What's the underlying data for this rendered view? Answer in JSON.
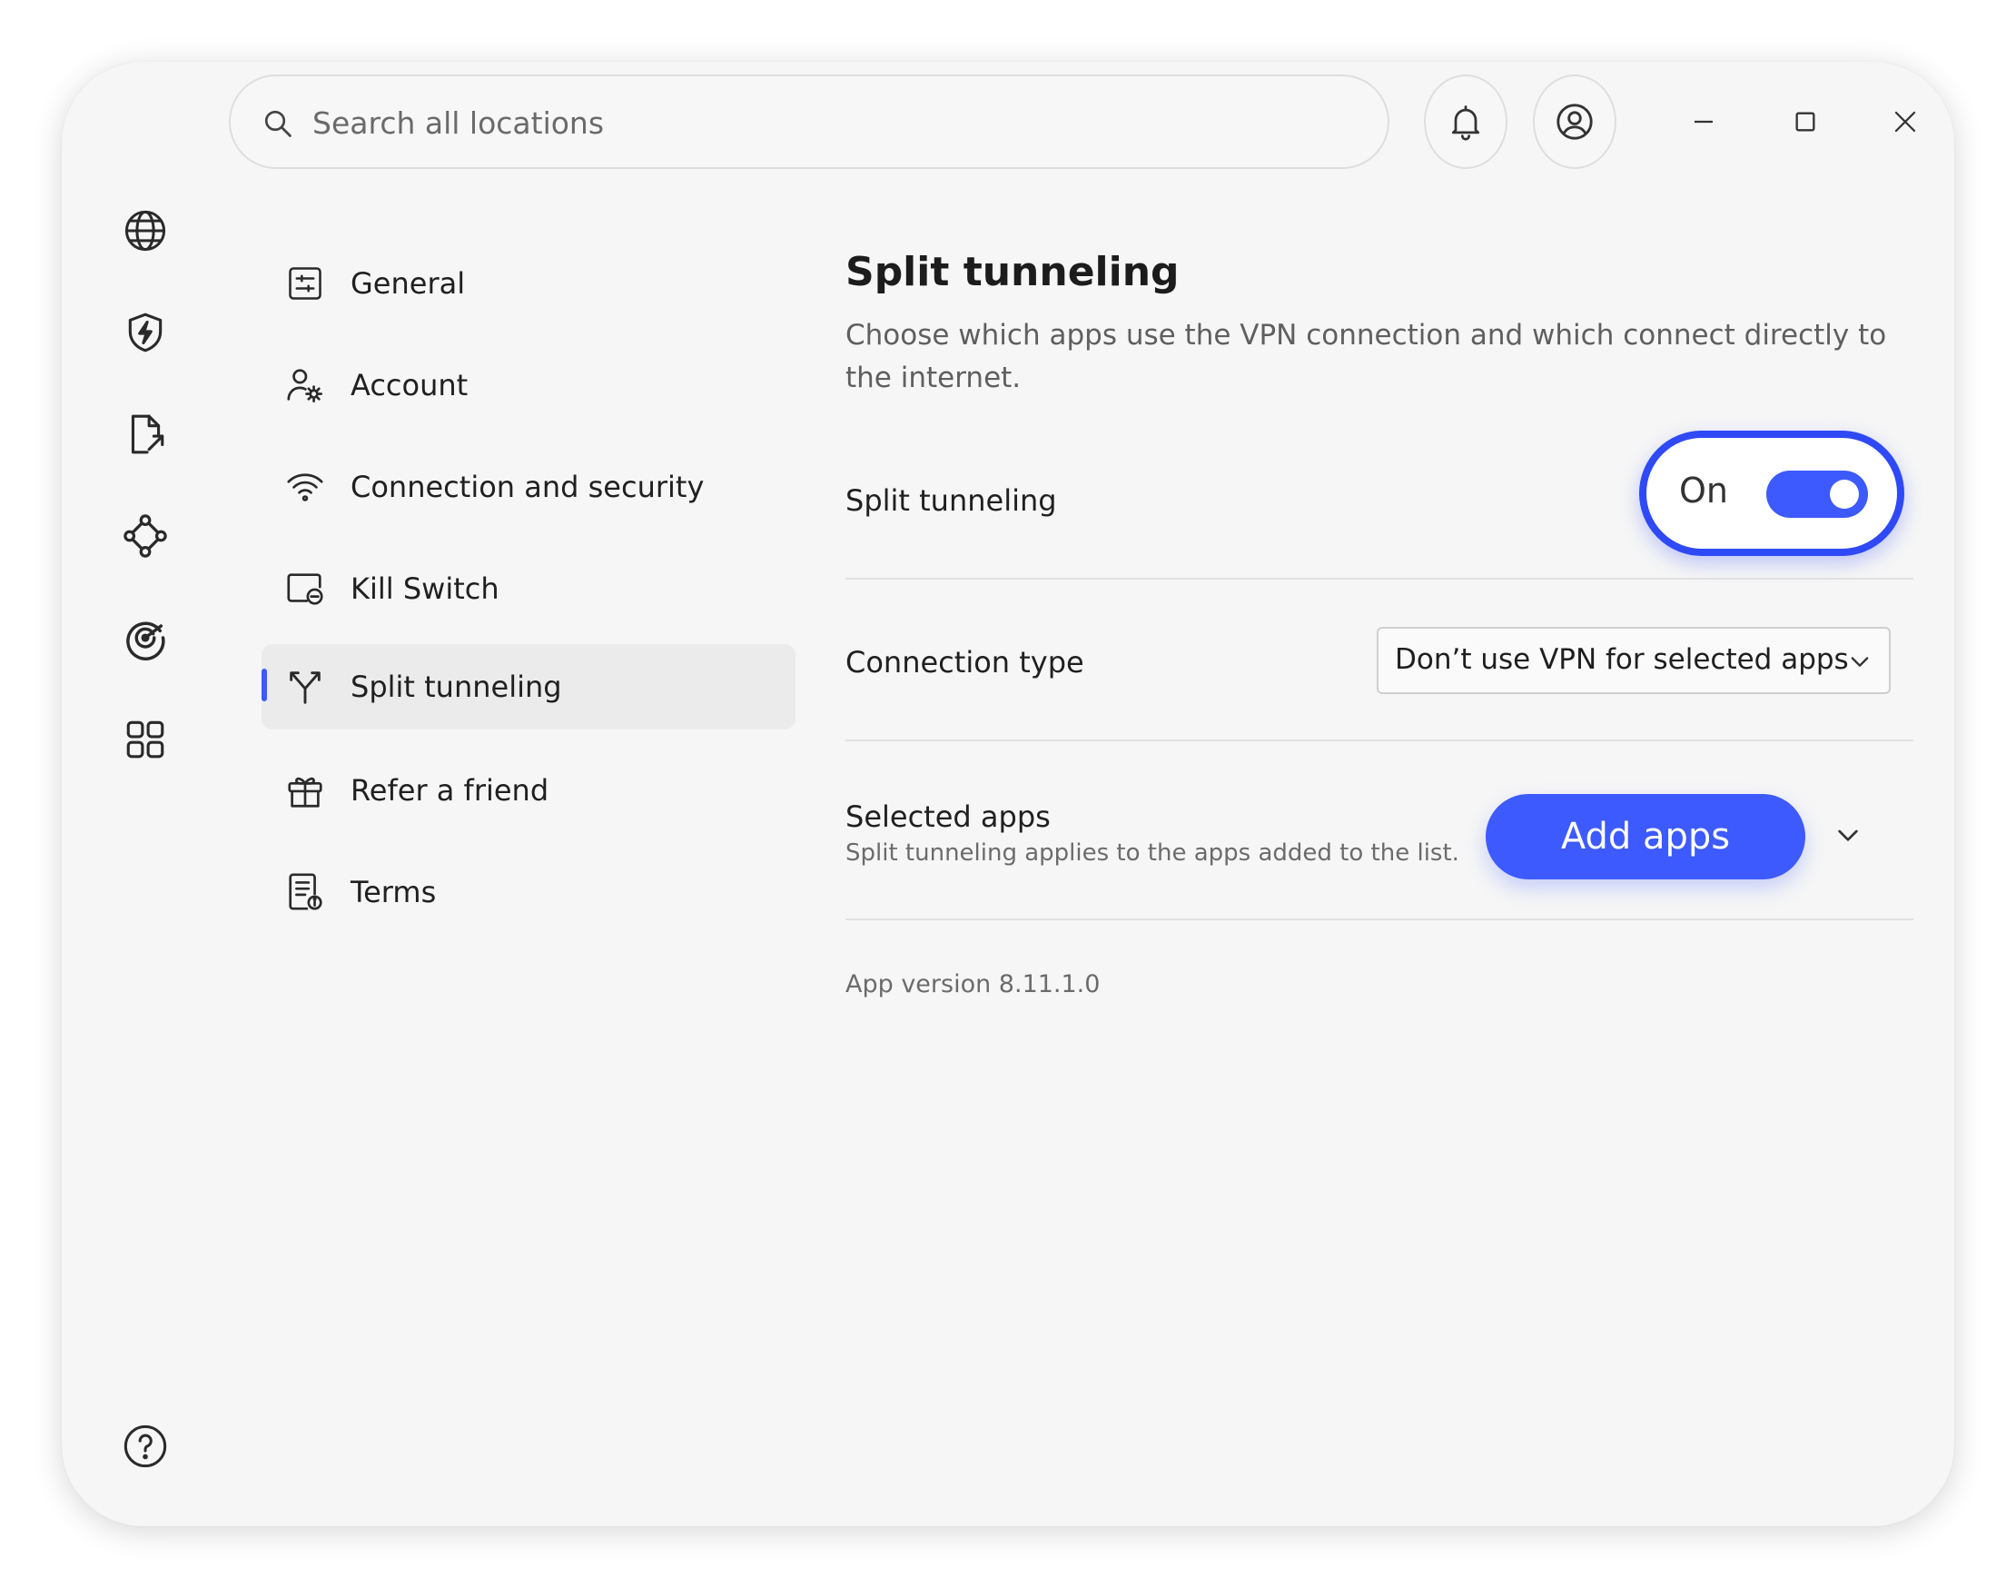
{
  "search": {
    "placeholder": "Search all locations"
  },
  "header": {
    "icons": [
      "bell-icon",
      "user-account-icon"
    ],
    "window_controls": [
      "minimize-icon",
      "maximize-icon",
      "close-icon"
    ]
  },
  "rail": {
    "icons": [
      "globe-icon",
      "shield-bolt-icon",
      "file-export-icon",
      "mesh-network-icon",
      "radar-icon",
      "grid-apps-icon",
      "help-icon"
    ]
  },
  "nav": {
    "items": [
      {
        "label": "General",
        "icon": "settings-sliders-icon"
      },
      {
        "label": "Account",
        "icon": "account-gear-icon"
      },
      {
        "label": "Connection and security",
        "icon": "wifi-icon"
      },
      {
        "label": "Kill Switch",
        "icon": "kill-switch-icon"
      },
      {
        "label": "Split tunneling",
        "icon": "split-tunnel-icon",
        "active": true
      },
      {
        "label": "Refer a friend",
        "icon": "gift-icon"
      },
      {
        "label": "Terms",
        "icon": "document-info-icon"
      }
    ]
  },
  "content": {
    "title": "Split tunneling",
    "description": "Choose which apps use the VPN connection and which connect directly to the internet.",
    "split_tunneling": {
      "label": "Split tunneling",
      "state_text": "On",
      "enabled": true
    },
    "connection_type": {
      "label": "Connection type",
      "value": "Don’t use VPN for selected apps"
    },
    "selected_apps": {
      "label": "Selected apps",
      "sublabel": "Split tunneling applies to the apps added to the list.",
      "button": "Add apps"
    },
    "version": "App version 8.11.1.0"
  },
  "colors": {
    "accent": "#3d5afe",
    "highlight_border": "#2e49f5",
    "window_bg": "#f6f6f6"
  }
}
